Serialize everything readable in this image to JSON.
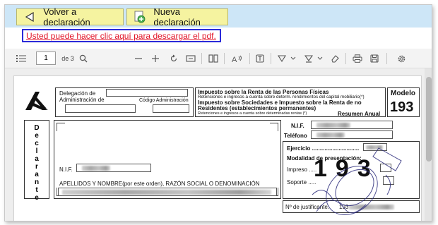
{
  "topbar": {
    "back_button": "Volver a declaración",
    "new_button": "Nueva declaración"
  },
  "download_link": "Usted puede hacer clic aquí para descargar el pdf.",
  "viewer_toolbar": {
    "page_number": "1",
    "page_total": "de 3"
  },
  "form": {
    "delegacion_label_1": "Delegación de",
    "delegacion_label_2": "Administración de",
    "codigo_label": "Código Administración",
    "title_1": "Impuesto sobre la Renta de las Personas Físicas",
    "subtitle_1": "Retenciones e ingresos a cuenta sobre determ. rendimientos del capital mobiliario(*)",
    "title_2": "Impuesto sobre Sociedades e Impuesto sobre la Renta de no",
    "title_3": "Residentes (establecimientos permanentes)",
    "subtitle_2": "Retenciones e ingresos a cuenta sobre determinadas rentas (*)",
    "resumen": "Resumen Anual",
    "modelo_label": "Modelo",
    "modelo_number": "193",
    "declarante_letters": [
      "D",
      "e",
      "c",
      "l",
      "a",
      "r",
      "a",
      "n",
      "t",
      "e"
    ],
    "nif_label": "N.I.F.",
    "nif_label_2": "N.I.F.",
    "apellidos_label": "APELLIDOS Y NOMBRE(por este orden),  RAZÓN SOCIAL O DENOMINACIÓN",
    "telefono_label": "Teléfono",
    "ejercicio_label": "Ejercicio ..............................",
    "modalidad_label": "Modalidad de presentación:",
    "impreso_label": "Impreso .....",
    "soporte_label": "Soporte .....",
    "justificante_label": "Nº de justificante:",
    "justificante_prefix": "193",
    "watermark_number": "193"
  }
}
